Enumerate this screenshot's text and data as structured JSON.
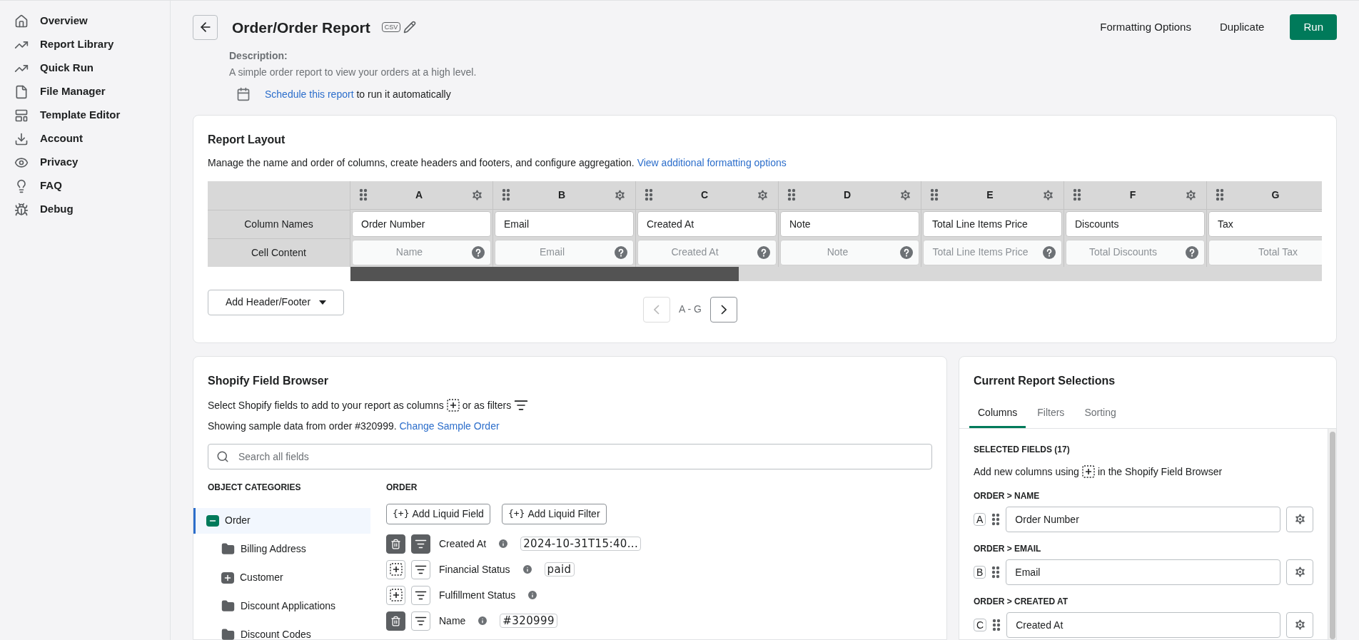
{
  "sidebar": {
    "items": [
      {
        "label": "Overview",
        "selected": false
      },
      {
        "label": "Report Library",
        "selected": false
      },
      {
        "label": "Quick Run",
        "selected": false
      },
      {
        "label": "File Manager",
        "selected": false
      },
      {
        "label": "Template Editor",
        "selected": false
      },
      {
        "label": "Account",
        "selected": false
      },
      {
        "label": "Privacy",
        "selected": false
      },
      {
        "label": "FAQ",
        "selected": false
      },
      {
        "label": "Debug",
        "selected": false
      }
    ]
  },
  "header": {
    "title": "Order/Order Report",
    "file_type": "CSV",
    "description_label": "Description:",
    "description": "A simple order report to view your orders at a high level.",
    "schedule_link": "Schedule this report",
    "schedule_text": "to run it automatically",
    "actions": [
      "Formatting Options",
      "Duplicate"
    ],
    "primary_action": "Run"
  },
  "report_layout": {
    "title": "Report Layout",
    "description": "Manage the name and order of columns, create headers and footers, and configure aggregation.",
    "link": "View additional formatting options",
    "row_labels": [
      "Column Names",
      "Cell Content"
    ],
    "columns": [
      {
        "letter": "A",
        "name": "Order Number",
        "content": "Name",
        "help": true
      },
      {
        "letter": "B",
        "name": "Email",
        "content": "Email",
        "help": true
      },
      {
        "letter": "C",
        "name": "Created At",
        "content": "Created At",
        "help": true
      },
      {
        "letter": "D",
        "name": "Note",
        "content": "Note",
        "help": true
      },
      {
        "letter": "E",
        "name": "Total Line Items Price",
        "content": "Total Line Items Price",
        "help": true
      },
      {
        "letter": "F",
        "name": "Discounts",
        "content": "Total Discounts",
        "help": true
      },
      {
        "letter": "G",
        "name": "Tax",
        "content": "Total Tax",
        "help": false
      }
    ],
    "add_button": "Add Header/Footer",
    "pager": {
      "label": "A - G",
      "prev_disabled": true,
      "next_disabled": false
    }
  },
  "field_browser": {
    "title": "Shopify Field Browser",
    "intro_start": "Select Shopify fields to add to your report as columns",
    "intro_mid": "or as filters",
    "sample_text": "Showing sample data from order #320999.",
    "sample_link": "Change Sample Order",
    "search": {
      "placeholder": "Search all fields"
    },
    "categories_title": "OBJECT CATEGORIES",
    "categories": [
      {
        "label": "Order",
        "kind": "expanded",
        "selected": true
      },
      {
        "label": "Billing Address",
        "kind": "folder",
        "selected": false
      },
      {
        "label": "Customer",
        "kind": "expandable",
        "selected": false
      },
      {
        "label": "Discount Applications",
        "kind": "folder",
        "selected": false
      },
      {
        "label": "Discount Codes",
        "kind": "folder",
        "selected": false
      }
    ],
    "fields_title": "ORDER",
    "liquid_buttons": [
      "Add Liquid Field",
      "Add Liquid Filter"
    ],
    "liquid_glyph": "{+}",
    "fields": [
      {
        "label": "Created At",
        "added": true,
        "filtered": true,
        "sample": "2024-10-31T15:40..."
      },
      {
        "label": "Financial Status",
        "added": false,
        "filtered": false,
        "sample": "paid"
      },
      {
        "label": "Fulfillment Status",
        "added": false,
        "filtered": false
      },
      {
        "label": "Name",
        "added": true,
        "filtered": false,
        "sample": "#320999"
      }
    ]
  },
  "selections": {
    "title": "Current Report Selections",
    "tabs": [
      {
        "label": "Columns",
        "selected": true
      },
      {
        "label": "Filters",
        "selected": false
      },
      {
        "label": "Sorting",
        "selected": false
      }
    ],
    "count_label": "SELECTED FIELDS (17)",
    "hint_start": "Add new columns using",
    "hint_end": "in the Shopify Field Browser",
    "fields": [
      {
        "path": "ORDER > NAME",
        "letter": "A",
        "value": "Order Number"
      },
      {
        "path": "ORDER > EMAIL",
        "letter": "B",
        "value": "Email"
      },
      {
        "path": "ORDER > CREATED AT",
        "letter": "C",
        "value": "Created At"
      }
    ]
  }
}
